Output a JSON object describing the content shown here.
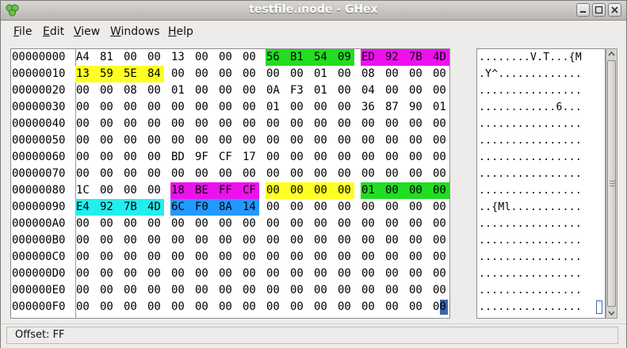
{
  "window": {
    "title": "testfile.inode - GHex"
  },
  "menubar": {
    "items": [
      {
        "label": "File"
      },
      {
        "label": "Edit"
      },
      {
        "label": "View"
      },
      {
        "label": "Windows"
      },
      {
        "label": "Help"
      }
    ]
  },
  "hex": {
    "offsets": [
      "00000000",
      "00000010",
      "00000020",
      "00000030",
      "00000040",
      "00000050",
      "00000060",
      "00000070",
      "00000080",
      "00000090",
      "000000A0",
      "000000B0",
      "000000C0",
      "000000D0",
      "000000E0",
      "000000F0"
    ],
    "rows": [
      [
        "A4",
        "81",
        "00",
        "00",
        "13",
        "00",
        "00",
        "00",
        "56",
        "B1",
        "54",
        "09",
        "ED",
        "92",
        "7B",
        "4D"
      ],
      [
        "13",
        "59",
        "5E",
        "84",
        "00",
        "00",
        "00",
        "00",
        "00",
        "00",
        "01",
        "00",
        "08",
        "00",
        "00",
        "00"
      ],
      [
        "00",
        "00",
        "08",
        "00",
        "01",
        "00",
        "00",
        "00",
        "0A",
        "F3",
        "01",
        "00",
        "04",
        "00",
        "00",
        "00"
      ],
      [
        "00",
        "00",
        "00",
        "00",
        "00",
        "00",
        "00",
        "00",
        "01",
        "00",
        "00",
        "00",
        "36",
        "87",
        "90",
        "01"
      ],
      [
        "00",
        "00",
        "00",
        "00",
        "00",
        "00",
        "00",
        "00",
        "00",
        "00",
        "00",
        "00",
        "00",
        "00",
        "00",
        "00"
      ],
      [
        "00",
        "00",
        "00",
        "00",
        "00",
        "00",
        "00",
        "00",
        "00",
        "00",
        "00",
        "00",
        "00",
        "00",
        "00",
        "00"
      ],
      [
        "00",
        "00",
        "00",
        "00",
        "BD",
        "9F",
        "CF",
        "17",
        "00",
        "00",
        "00",
        "00",
        "00",
        "00",
        "00",
        "00"
      ],
      [
        "00",
        "00",
        "00",
        "00",
        "00",
        "00",
        "00",
        "00",
        "00",
        "00",
        "00",
        "00",
        "00",
        "00",
        "00",
        "00"
      ],
      [
        "1C",
        "00",
        "00",
        "00",
        "18",
        "BE",
        "FF",
        "CF",
        "00",
        "00",
        "00",
        "00",
        "01",
        "00",
        "00",
        "00"
      ],
      [
        "E4",
        "92",
        "7B",
        "4D",
        "6C",
        "F0",
        "8A",
        "14",
        "00",
        "00",
        "00",
        "00",
        "00",
        "00",
        "00",
        "00"
      ],
      [
        "00",
        "00",
        "00",
        "00",
        "00",
        "00",
        "00",
        "00",
        "00",
        "00",
        "00",
        "00",
        "00",
        "00",
        "00",
        "00"
      ],
      [
        "00",
        "00",
        "00",
        "00",
        "00",
        "00",
        "00",
        "00",
        "00",
        "00",
        "00",
        "00",
        "00",
        "00",
        "00",
        "00"
      ],
      [
        "00",
        "00",
        "00",
        "00",
        "00",
        "00",
        "00",
        "00",
        "00",
        "00",
        "00",
        "00",
        "00",
        "00",
        "00",
        "00"
      ],
      [
        "00",
        "00",
        "00",
        "00",
        "00",
        "00",
        "00",
        "00",
        "00",
        "00",
        "00",
        "00",
        "00",
        "00",
        "00",
        "00"
      ],
      [
        "00",
        "00",
        "00",
        "00",
        "00",
        "00",
        "00",
        "00",
        "00",
        "00",
        "00",
        "00",
        "00",
        "00",
        "00",
        "00"
      ],
      [
        "00",
        "00",
        "00",
        "00",
        "00",
        "00",
        "00",
        "00",
        "00",
        "00",
        "00",
        "00",
        "00",
        "00",
        "00",
        "00"
      ]
    ],
    "highlights": [
      {
        "row": 0,
        "start": 8,
        "end": 11,
        "color": "#22dd22"
      },
      {
        "row": 0,
        "start": 12,
        "end": 15,
        "color": "#ee11ee"
      },
      {
        "row": 1,
        "start": 0,
        "end": 3,
        "color": "#ffff22"
      },
      {
        "row": 8,
        "start": 4,
        "end": 7,
        "color": "#ee11ee"
      },
      {
        "row": 8,
        "start": 8,
        "end": 11,
        "color": "#ffff22"
      },
      {
        "row": 8,
        "start": 12,
        "end": 15,
        "color": "#22dd22"
      },
      {
        "row": 9,
        "start": 0,
        "end": 3,
        "color": "#22eeee"
      },
      {
        "row": 9,
        "start": 4,
        "end": 7,
        "color": "#2299ff"
      }
    ],
    "cursor": {
      "row": 15,
      "col": 15,
      "color": "#3b66a8"
    }
  },
  "ascii": {
    "rows": [
      "........V.T...{M",
      ".Y^.............",
      "................",
      "............6...",
      "................",
      "................",
      "................",
      "................",
      "................",
      "..{Ml...........",
      "................",
      "................",
      "................",
      "................",
      "................",
      "................"
    ]
  },
  "statusbar": {
    "offset_text": "Offset: FF"
  }
}
